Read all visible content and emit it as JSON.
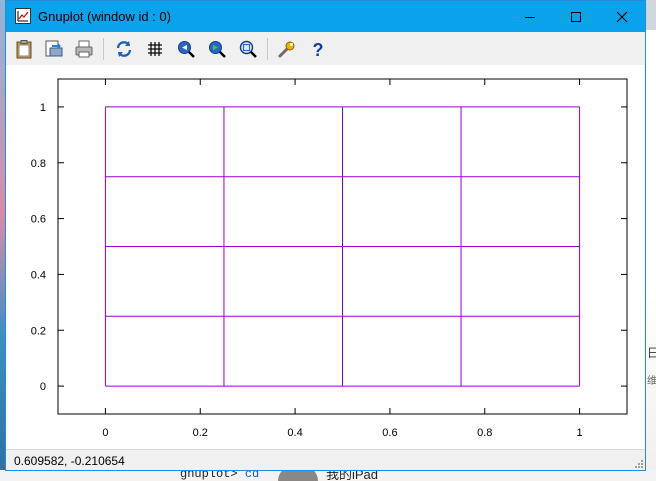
{
  "window": {
    "title": "Gnuplot (window id : 0)"
  },
  "toolbar": {
    "buttons": [
      {
        "icon": "clipboard-icon"
      },
      {
        "icon": "export-icon"
      },
      {
        "icon": "print-icon"
      },
      {
        "icon": "replot-icon"
      },
      {
        "icon": "grid-icon"
      },
      {
        "icon": "zoom-previous-icon"
      },
      {
        "icon": "zoom-next-icon"
      },
      {
        "icon": "unzoom-icon"
      },
      {
        "icon": "options-wrench-icon"
      },
      {
        "icon": "help-icon"
      }
    ]
  },
  "status": {
    "coords": "0.609582, -0.210654"
  },
  "desktop": {
    "terminal_prompt": "gnuplot> ",
    "terminal_cmd": "cd",
    "ipad_label": "我的iPad",
    "side_char": "日",
    "side_char2": "维"
  },
  "colors": {
    "titlebar": "#0aa2ea",
    "grid_line": "#9400d3",
    "axis": "#000000"
  },
  "chart_data": {
    "type": "line",
    "x_ticks": [
      "0",
      "0.2",
      "0.4",
      "0.6",
      "0.8",
      "1"
    ],
    "y_ticks": [
      "0",
      "0.2",
      "0.4",
      "0.6",
      "0.8",
      "1"
    ],
    "xlim": [
      -0.1,
      1.1
    ],
    "ylim": [
      -0.1,
      1.1
    ],
    "series": [
      {
        "values_x": [
          0,
          1
        ],
        "values_y": [
          0,
          0
        ]
      },
      {
        "values_x": [
          0,
          1
        ],
        "values_y": [
          0.25,
          0.25
        ]
      },
      {
        "values_x": [
          0,
          1
        ],
        "values_y": [
          0.5,
          0.5
        ]
      },
      {
        "values_x": [
          0,
          1
        ],
        "values_y": [
          0.75,
          0.75
        ]
      },
      {
        "values_x": [
          0,
          1
        ],
        "values_y": [
          1,
          1
        ]
      },
      {
        "values_x": [
          0,
          0
        ],
        "values_y": [
          0,
          1
        ]
      },
      {
        "values_x": [
          0.25,
          0.25
        ],
        "values_y": [
          0,
          1
        ]
      },
      {
        "values_x": [
          0.5,
          0.5
        ],
        "values_y": [
          0,
          1
        ]
      },
      {
        "values_x": [
          0.75,
          0.75
        ],
        "values_y": [
          0,
          1
        ]
      },
      {
        "values_x": [
          1,
          1
        ],
        "values_y": [
          0,
          1
        ]
      }
    ]
  }
}
